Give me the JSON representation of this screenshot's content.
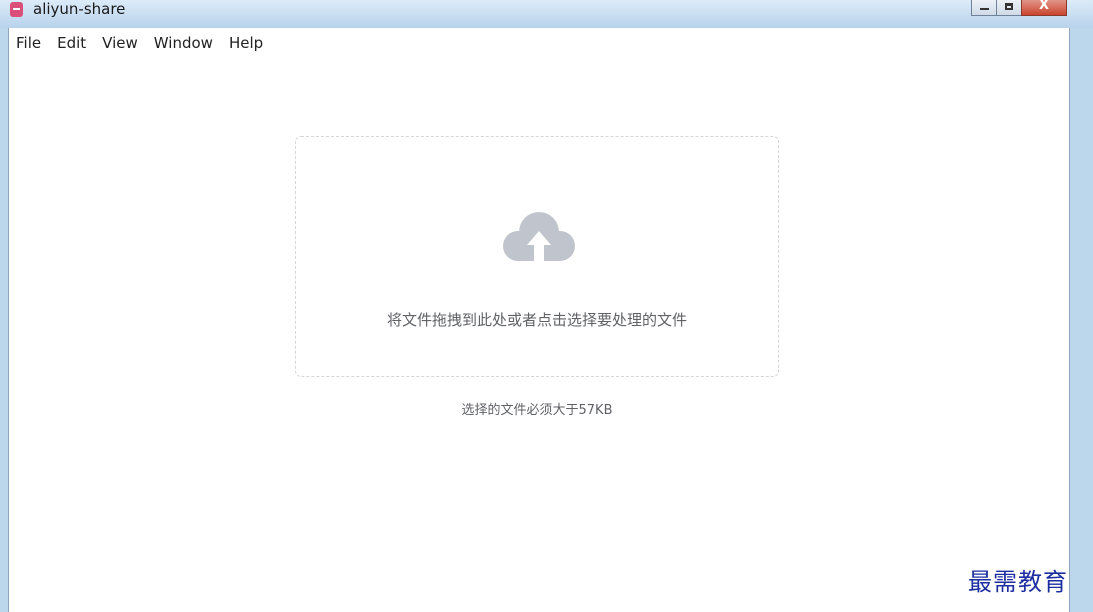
{
  "window": {
    "title": "aliyun-share",
    "controls": {
      "minimize": "",
      "maximize": "",
      "close": "X"
    }
  },
  "menubar": {
    "items": [
      {
        "label": "File"
      },
      {
        "label": "Edit"
      },
      {
        "label": "View"
      },
      {
        "label": "Window"
      },
      {
        "label": "Help"
      }
    ]
  },
  "upload": {
    "icon": "cloud-upload-icon",
    "drop_text": "将文件拖拽到此处或者点击选择要处理的文件",
    "limit_text": "选择的文件必须大于57KB"
  },
  "watermark": {
    "text": "最需教育"
  },
  "colors": {
    "title_bar": "#c6dcf1",
    "icon_gray": "#c0c4cc",
    "text_gray": "#606266",
    "watermark": "#1c2ea0",
    "app_icon": "#d94f7a"
  }
}
